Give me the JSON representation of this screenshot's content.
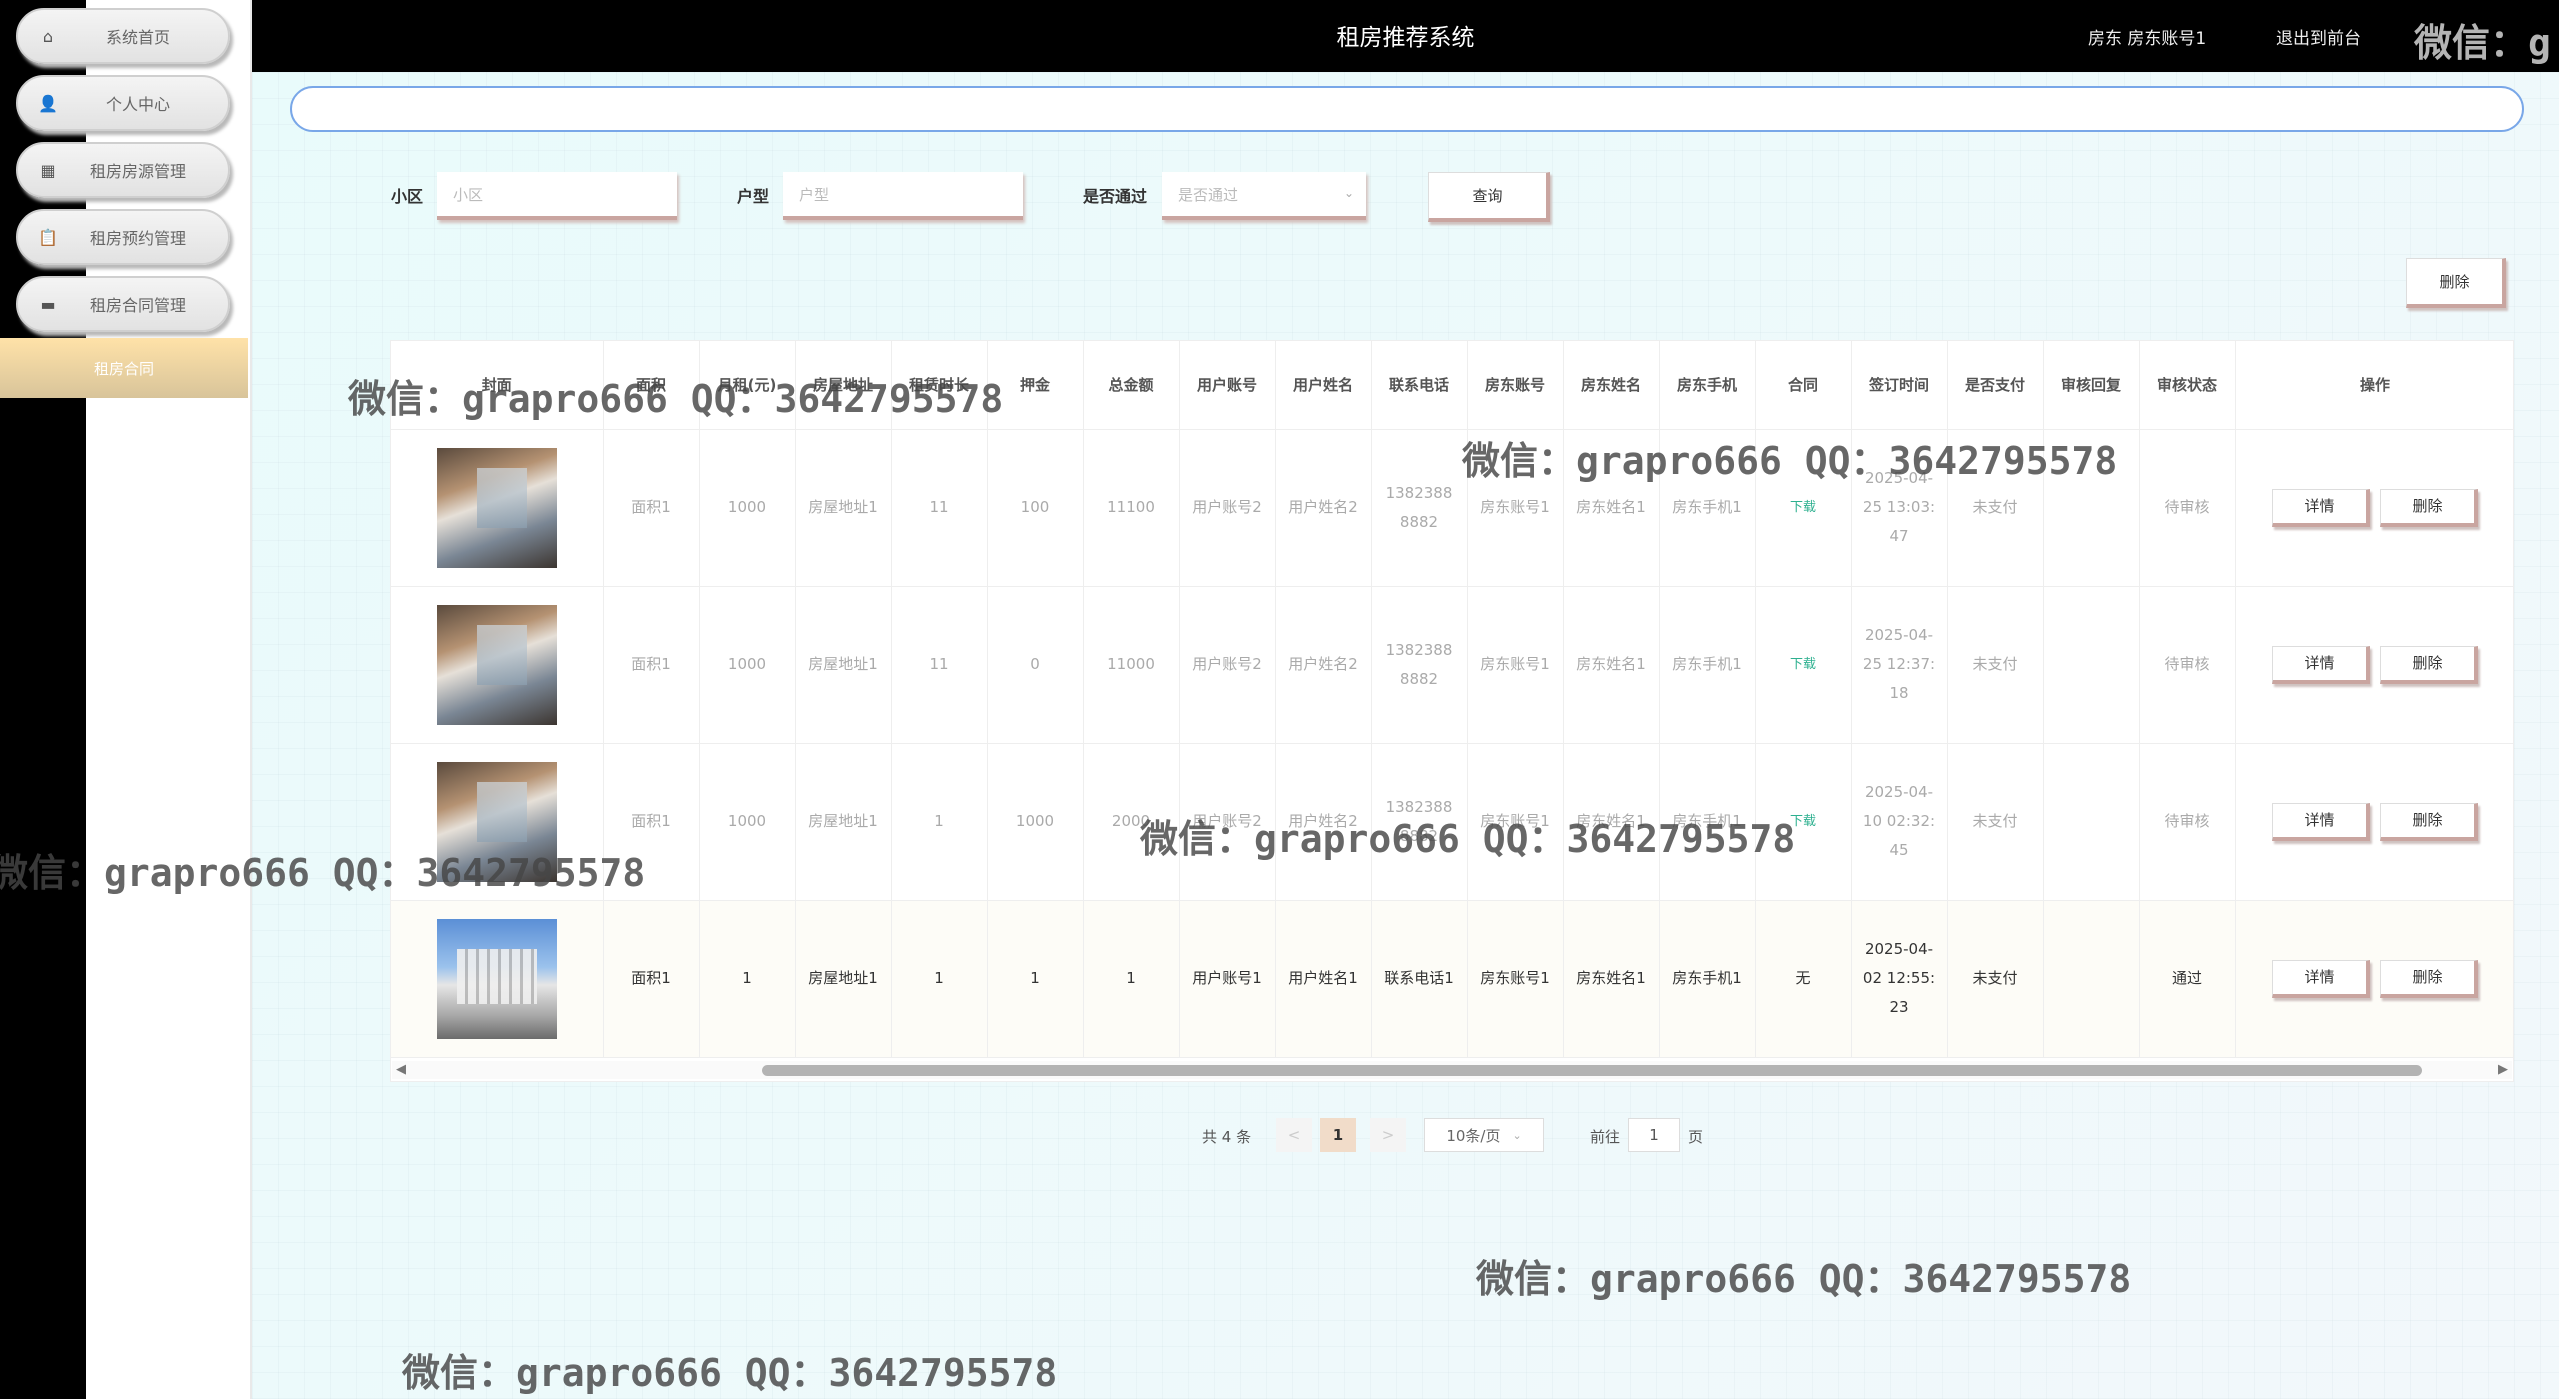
{
  "app": {
    "title": "租房推荐系统",
    "user_label": "房东 房东账号1",
    "logout_label": "退出到前台"
  },
  "sidebar": {
    "items": [
      {
        "label": "系统首页",
        "icon": "home-icon"
      },
      {
        "label": "个人中心",
        "icon": "user-icon"
      },
      {
        "label": "租房房源管理",
        "icon": "grid-icon"
      },
      {
        "label": "租房预约管理",
        "icon": "clipboard-icon"
      },
      {
        "label": "租房合同管理",
        "icon": "monitor-icon"
      }
    ],
    "active_sub": "租房合同"
  },
  "search": {
    "community_label": "小区",
    "community_placeholder": "小区",
    "layout_label": "户型",
    "layout_placeholder": "户型",
    "approved_label": "是否通过",
    "approved_placeholder": "是否通过",
    "query_button": "查询"
  },
  "toolbar": {
    "delete_button": "删除"
  },
  "table": {
    "headers": [
      "封面",
      "面积",
      "月租(元)",
      "房屋地址",
      "租赁时长",
      "押金",
      "总金额",
      "用户账号",
      "用户姓名",
      "联系电话",
      "房东账号",
      "房东姓名",
      "房东手机",
      "合同",
      "签订时间",
      "是否支付",
      "审核回复",
      "审核状态",
      "操作"
    ],
    "rows": [
      {
        "area": "面积1",
        "rent": "1000",
        "address": "房屋地址1",
        "duration": "11",
        "deposit": "100",
        "total": "11100",
        "user_account": "用户账号2",
        "user_name": "用户姓名2",
        "phone": "13823888882",
        "landlord_account": "房东账号1",
        "landlord_name": "房东姓名1",
        "landlord_phone": "房东手机1",
        "contract": "下载",
        "signed": "2025-04-25 13:03:47",
        "paid": "未支付",
        "reply": "",
        "status": "待审核",
        "detail": "详情",
        "delete": "删除"
      },
      {
        "area": "面积1",
        "rent": "1000",
        "address": "房屋地址1",
        "duration": "11",
        "deposit": "0",
        "total": "11000",
        "user_account": "用户账号2",
        "user_name": "用户姓名2",
        "phone": "13823888882",
        "landlord_account": "房东账号1",
        "landlord_name": "房东姓名1",
        "landlord_phone": "房东手机1",
        "contract": "下载",
        "signed": "2025-04-25 12:37:18",
        "paid": "未支付",
        "reply": "",
        "status": "待审核",
        "detail": "详情",
        "delete": "删除"
      },
      {
        "area": "面积1",
        "rent": "1000",
        "address": "房屋地址1",
        "duration": "1",
        "deposit": "1000",
        "total": "2000",
        "user_account": "用户账号2",
        "user_name": "用户姓名2",
        "phone": "13823888882",
        "landlord_account": "房东账号1",
        "landlord_name": "房东姓名1",
        "landlord_phone": "房东手机1",
        "contract": "下载",
        "signed": "2025-04-10 02:32:45",
        "paid": "未支付",
        "reply": "",
        "status": "待审核",
        "detail": "详情",
        "delete": "删除"
      },
      {
        "area": "面积1",
        "rent": "1",
        "address": "房屋地址1",
        "duration": "1",
        "deposit": "1",
        "total": "1",
        "user_account": "用户账号1",
        "user_name": "用户姓名1",
        "phone": "联系电话1",
        "landlord_account": "房东账号1",
        "landlord_name": "房东姓名1",
        "landlord_phone": "房东手机1",
        "contract": "无",
        "signed": "2025-04-02 12:55:23",
        "paid": "未支付",
        "reply": "",
        "status": "通过",
        "detail": "详情",
        "delete": "删除"
      }
    ]
  },
  "pagination": {
    "total": "共 4 条",
    "prev": "<",
    "current": "1",
    "next": ">",
    "page_size": "10条/页",
    "goto_label": "前往",
    "goto_value": "1",
    "page_suffix": "页"
  },
  "watermark": {
    "text": "微信：grapro666 QQ：3642795578",
    "partial": "微信：g"
  }
}
